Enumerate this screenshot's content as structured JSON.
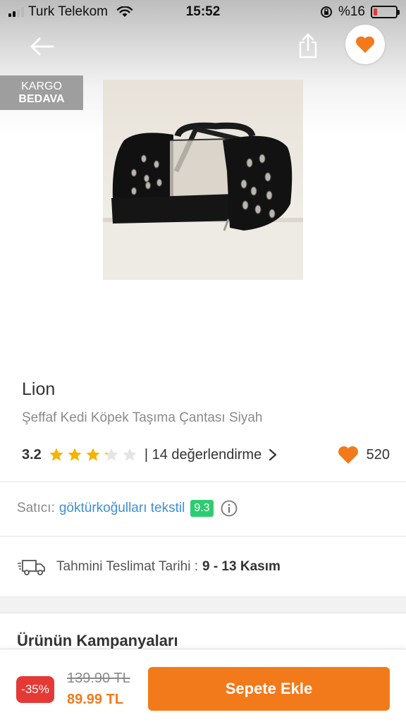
{
  "status_bar": {
    "carrier": "Turk Telekom",
    "time": "15:52",
    "battery_percent": "%16",
    "battery_level": 0.16
  },
  "header": {
    "back_icon": "arrow-left-icon",
    "share_icon": "share-icon",
    "favorite_icon": "heart-icon"
  },
  "badge": {
    "line1": "KARGO",
    "line2": "BEDAVA"
  },
  "product": {
    "brand": "Lion",
    "name": "Şeffaf Kedi Köpek Taşıma Çantası Siyah",
    "rating": "3.2",
    "rating_value": 3.2,
    "rating_max": 5,
    "reviews_text": "| 14 değerlendirme",
    "favorites_count": "520"
  },
  "seller": {
    "label": "Satıcı:",
    "name": "göktürkoğulları tekstil",
    "score": "9.3"
  },
  "delivery": {
    "label": "Tahmini Teslimat Tarihi :",
    "value": "9 - 13 Kasım"
  },
  "campaigns": {
    "title": "Ürünün Kampanyaları"
  },
  "bottom_bar": {
    "discount": "-35%",
    "old_price": "139.90 TL",
    "new_price": "89.99 TL",
    "add_to_cart": "Sepete Ekle"
  },
  "colors": {
    "accent": "#f27a1a",
    "seller_link": "#3d8fd6",
    "score_badge": "#2ecc71",
    "discount_badge": "#e53935",
    "star": "#f5b400"
  }
}
